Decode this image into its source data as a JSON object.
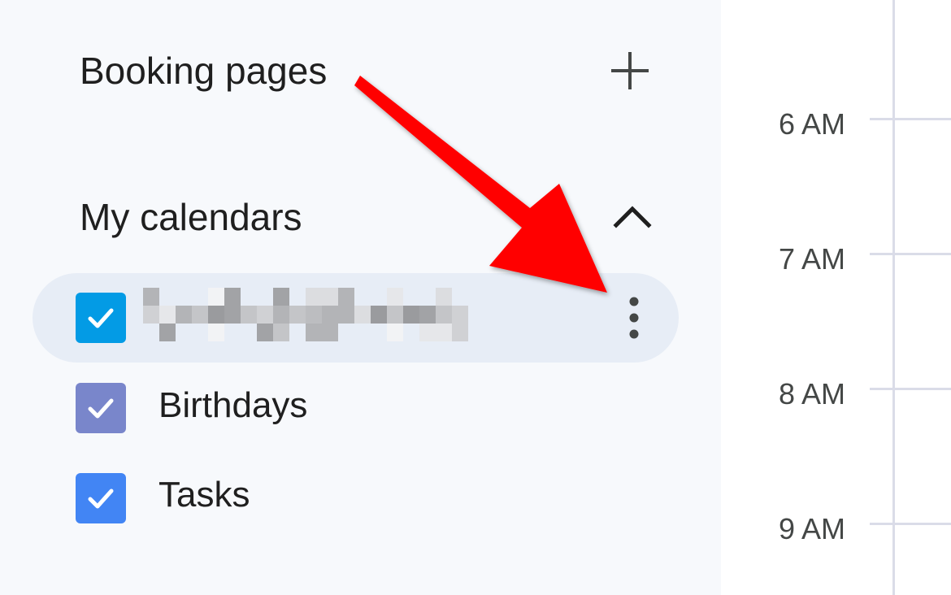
{
  "sidebar": {
    "booking_pages": {
      "title": "Booking pages",
      "add_icon": "plus-icon"
    },
    "my_calendars": {
      "title": "My calendars",
      "toggle_icon": "chevron-up-icon",
      "items": [
        {
          "label": "",
          "checked": true,
          "color": "#039be5",
          "name_obscured": true,
          "more_icon": "more-vert-icon"
        },
        {
          "label": "Birthdays",
          "checked": true,
          "color": "#7986cb"
        },
        {
          "label": "Tasks",
          "checked": true,
          "color": "#4285f4"
        }
      ]
    }
  },
  "timeline": {
    "hours": [
      "6 AM",
      "7 AM",
      "8 AM",
      "9 AM"
    ]
  },
  "annotation": {
    "color": "#ff0000",
    "icon": "red-arrow-icon"
  }
}
